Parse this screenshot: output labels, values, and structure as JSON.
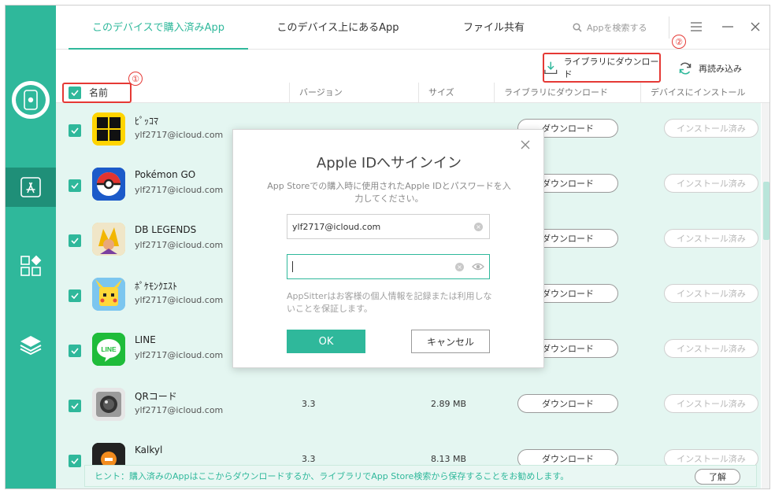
{
  "tabs": [
    {
      "label": "このデバイスで購入済みApp",
      "active": true
    },
    {
      "label": "このデバイス上にあるApp",
      "active": false
    },
    {
      "label": "ファイル共有",
      "active": false
    }
  ],
  "search": {
    "placeholder": "Appを検索する"
  },
  "toolbar": {
    "download_to_library": "ライブラリにダウンロード",
    "reload": "再読み込み",
    "badge_1": "①",
    "badge_2": "②"
  },
  "table": {
    "headers": {
      "name": "名前",
      "version": "バージョン",
      "size": "サイズ",
      "library": "ライブラリにダウンロード",
      "device": "デバイスにインストール"
    },
    "rows": [
      {
        "name": "ﾋﾟｯｺﾏ",
        "account": "ylf2717@icloud.com",
        "version": "",
        "size": "",
        "download": "ダウンロード",
        "install": "インストール済み"
      },
      {
        "name": "Pokémon GO",
        "account": "ylf2717@icloud.com",
        "version": "",
        "size": "",
        "download": "ダウンロード",
        "install": "インストール済み"
      },
      {
        "name": "DB LEGENDS",
        "account": "ylf2717@icloud.com",
        "version": "",
        "size": "",
        "download": "ダウンロード",
        "install": "インストール済み"
      },
      {
        "name": "ﾎﾟｹﾓﾝｸｴｽﾄ",
        "account": "ylf2717@icloud.com",
        "version": "",
        "size": "",
        "download": "ダウンロード",
        "install": "インストール済み"
      },
      {
        "name": "LINE",
        "account": "ylf2717@icloud.com",
        "version": "",
        "size": "",
        "download": "ダウンロード",
        "install": "インストール済み"
      },
      {
        "name": "QRコード",
        "account": "ylf2717@icloud.com",
        "version": "3.3",
        "size": "2.89 MB",
        "download": "ダウンロード",
        "install": "インストール済み"
      },
      {
        "name": "Kalkyl",
        "account": "",
        "version": "3.3",
        "size": "8.13 MB",
        "download": "ダウンロード",
        "install": "インストール済み"
      }
    ]
  },
  "hint": {
    "text": "ヒント：購入済みのAppはここからダウンロードするか、ライブラリでApp Store検索から保存することをお勧めします。",
    "button": "了解"
  },
  "dialog": {
    "title": "Apple IDへサインイン",
    "description": "App Storeでの購入時に使用されたApple IDとパスワードを入力してください。",
    "email_value": "ylf2717@icloud.com",
    "note": "AppSitterはお客様の個人情報を記録または利用しないことを保証します。",
    "ok": "OK",
    "cancel": "キャンセル"
  },
  "icons": {
    "line_label": "LINE"
  },
  "colors": {
    "accent": "#2fb89b",
    "annotation": "#e53935"
  }
}
